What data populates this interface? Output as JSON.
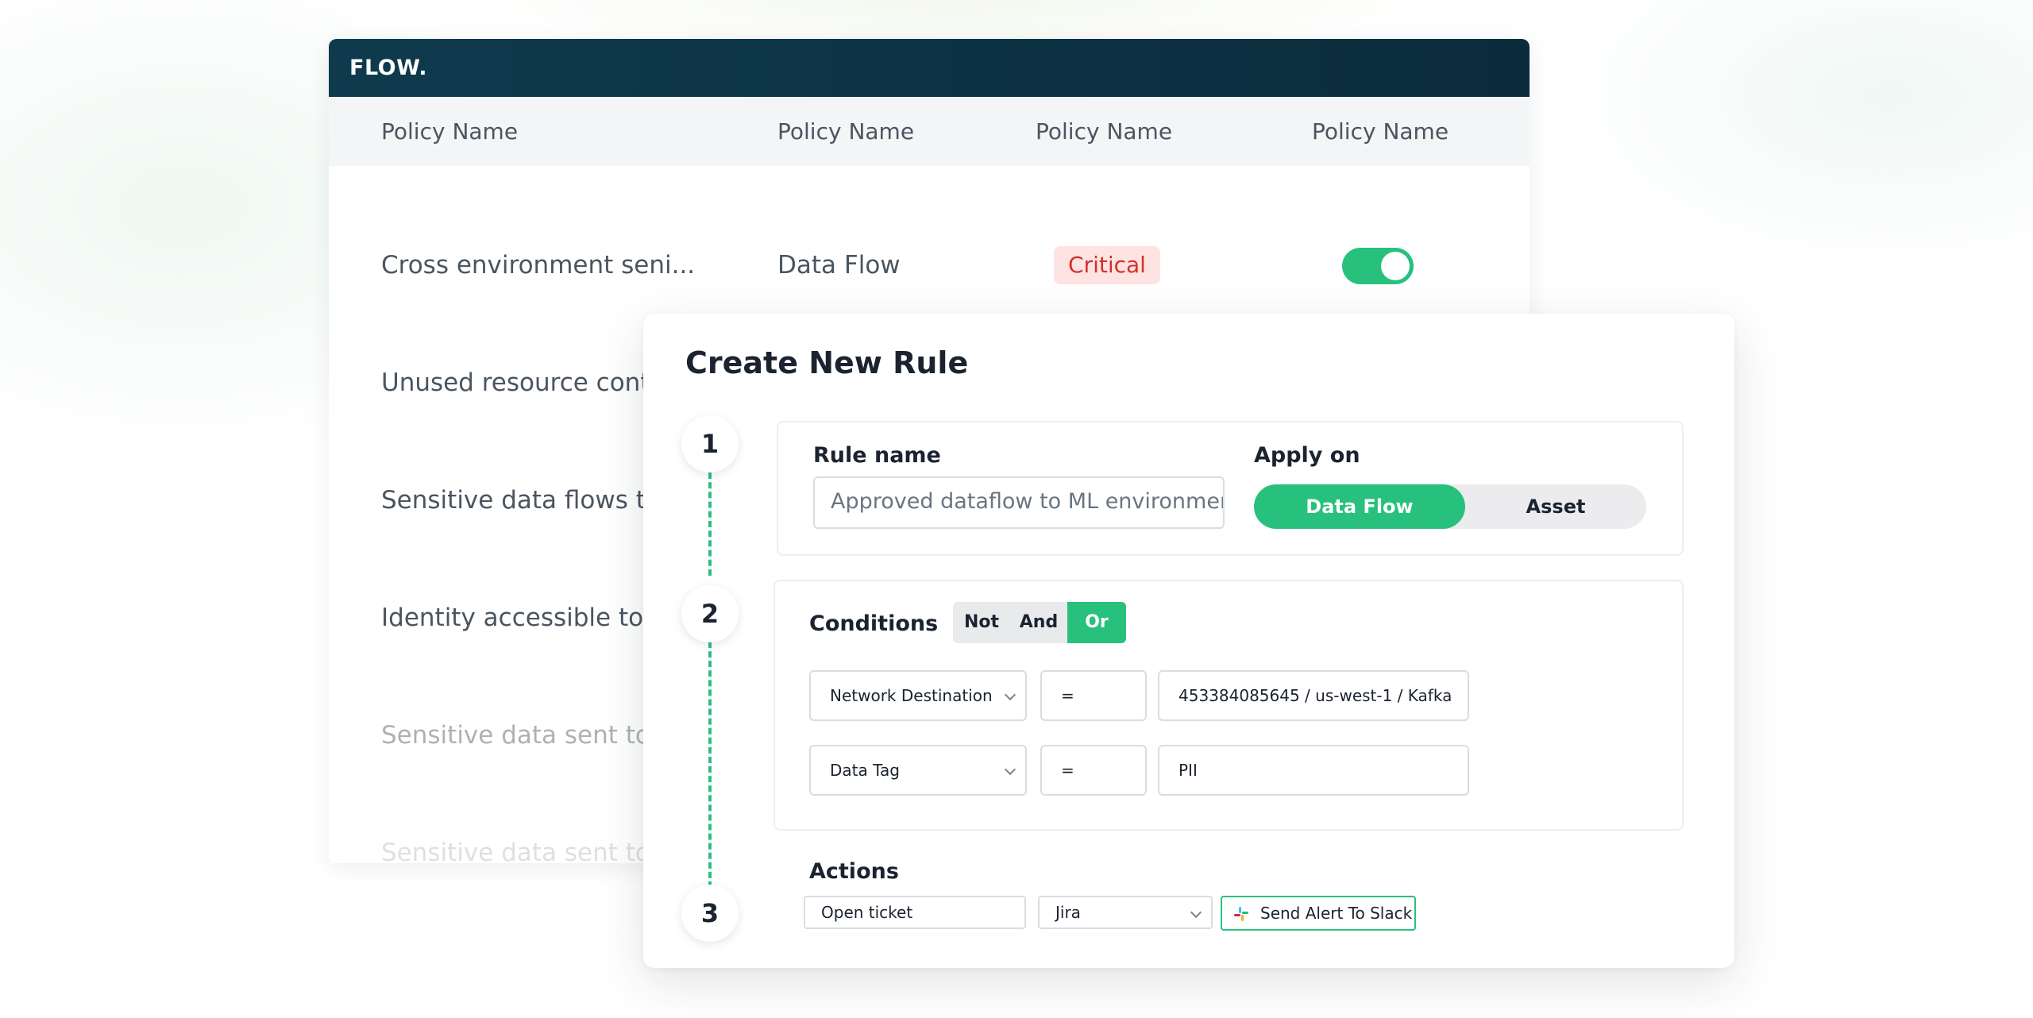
{
  "app": {
    "logo": "FLOW."
  },
  "table": {
    "headers": [
      "Policy Name",
      "Policy Name",
      "Policy Name",
      "Policy Name"
    ],
    "rows": [
      {
        "name": "Cross environment seni...",
        "type": "Data Flow",
        "severity": "Critical",
        "enabled": true
      },
      {
        "name": "Unused resource conta"
      },
      {
        "name": "Sensitive data flows to"
      },
      {
        "name": "Identity accessible to M"
      },
      {
        "name": "Sensitive data sent to e"
      },
      {
        "name": "Sensitive data sent to e"
      }
    ]
  },
  "modal": {
    "title": "Create New Rule",
    "steps": [
      "1",
      "2",
      "3"
    ],
    "rule_name": {
      "label": "Rule name",
      "value": "Approved dataflow to ML environment"
    },
    "apply_on": {
      "label": "Apply on",
      "options": [
        "Data Flow",
        "Asset"
      ],
      "selected": "Data Flow"
    },
    "conditions": {
      "label": "Conditions",
      "operators": [
        "Not",
        "And",
        "Or"
      ],
      "selected": "Or",
      "rows": [
        {
          "field": "Network Destination",
          "operator": "=",
          "value": "453384085645 / us-west-1 / Kafka"
        },
        {
          "field": "Data Tag",
          "operator": "=",
          "value": "PII"
        }
      ]
    },
    "actions": {
      "label": "Actions",
      "action": "Open ticket",
      "integration": "Jira",
      "slack_button": "Send Alert To Slack"
    }
  },
  "colors": {
    "accent": "#27c17d",
    "header_bg": "#0f3a4d",
    "critical_bg": "#fde3e1",
    "critical_text": "#d3302a"
  },
  "icons": [
    "chevron-down-icon",
    "slack-icon"
  ]
}
